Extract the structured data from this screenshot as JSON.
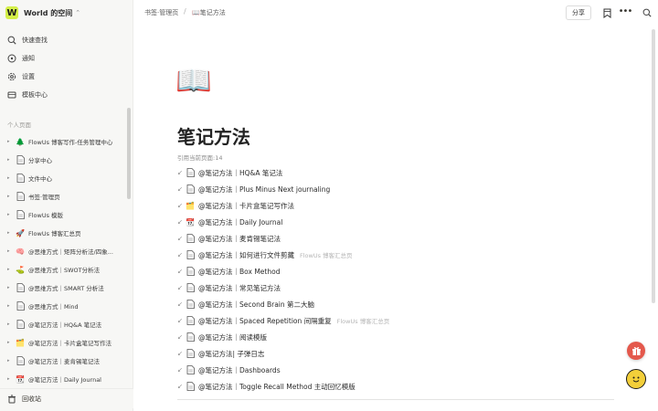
{
  "workspace": {
    "logo_letter": "W",
    "name": "World 的空间"
  },
  "nav": [
    {
      "icon": "search-icon",
      "label": "快速查找"
    },
    {
      "icon": "bell-icon",
      "label": "通知"
    },
    {
      "icon": "gear-icon",
      "label": "设置"
    },
    {
      "icon": "template-icon",
      "label": "模板中心"
    }
  ],
  "sidebar_section": "个人页面",
  "tree": [
    {
      "icon": "🌲",
      "label": "FlowUs 博客写作-任务管理中心"
    },
    {
      "icon": "doc",
      "label": "分享中心"
    },
    {
      "icon": "doc",
      "label": "文件中心"
    },
    {
      "icon": "doc",
      "label": "书签·管理页"
    },
    {
      "icon": "doc",
      "label": "FlowUs 模版"
    },
    {
      "icon": "🚀",
      "label": "FlowUs 博客汇总页"
    },
    {
      "icon": "🧠",
      "label": "@思维方式｜矩阵分析法/四象..."
    },
    {
      "icon": "⛳",
      "label": "@思维方式｜SWOT分析法"
    },
    {
      "icon": "doc",
      "label": "@思维方式｜SMART 分析法"
    },
    {
      "icon": "doc",
      "label": "@思维方式｜Mind"
    },
    {
      "icon": "doc",
      "label": "@笔记方法｜HQ&A 笔记法"
    },
    {
      "icon": "🗂️",
      "label": "@笔记方法｜卡片盒笔记写作法"
    },
    {
      "icon": "doc",
      "label": "@笔记方法｜麦肯锡笔记法"
    },
    {
      "icon": "📆",
      "label": "@笔记方法｜Daily Journal"
    }
  ],
  "trash_label": "回收站",
  "breadcrumb": {
    "parent": "书签·管理页",
    "sep": "/",
    "current_icon": "📖",
    "current": "笔记方法"
  },
  "toolbar": {
    "share_label": "分享"
  },
  "page": {
    "icon": "📖",
    "title": "笔记方法",
    "ref_label": "引用当前页面:14",
    "links": [
      {
        "icon": "doc",
        "text": "@笔记方法｜HQ&A 笔记法",
        "suffix": ""
      },
      {
        "icon": "doc",
        "text": "@笔记方法｜Plus Minus Next journaling",
        "suffix": ""
      },
      {
        "icon": "🗂️",
        "text": "@笔记方法｜卡片盒笔记写作法",
        "suffix": ""
      },
      {
        "icon": "📆",
        "text": "@笔记方法｜Daily Journal",
        "suffix": ""
      },
      {
        "icon": "doc",
        "text": "@笔记方法｜麦肯锡笔记法",
        "suffix": ""
      },
      {
        "icon": "doc",
        "text": "@笔记方法｜如何进行文件剪藏",
        "suffix": "FlowUs 博客汇总页"
      },
      {
        "icon": "doc",
        "text": "@笔记方法｜Box Method",
        "suffix": ""
      },
      {
        "icon": "doc",
        "text": "@笔记方法｜常见笔记方法",
        "suffix": ""
      },
      {
        "icon": "doc",
        "text": "@笔记方法｜Second Brain 第二大脑",
        "suffix": ""
      },
      {
        "icon": "doc",
        "text": "@笔记方法｜Spaced Repetition 间隔重复",
        "suffix": "FlowUs 博客汇总页"
      },
      {
        "icon": "doc",
        "text": "@笔记方法｜阅读模版",
        "suffix": ""
      },
      {
        "icon": "doc",
        "text": "@笔记方法| 子弹日志",
        "suffix": ""
      },
      {
        "icon": "doc",
        "text": "@笔记方法｜Dashboards",
        "suffix": ""
      },
      {
        "icon": "doc",
        "text": "@笔记方法｜Toggle Recall Method 主动回忆模版",
        "suffix": ""
      }
    ]
  },
  "colors": {
    "sidebar_bg": "#f7f7f5",
    "logo_bg": "#d4ef48",
    "gift_bg": "#e4584c",
    "face_bg": "#f3cf3a"
  }
}
